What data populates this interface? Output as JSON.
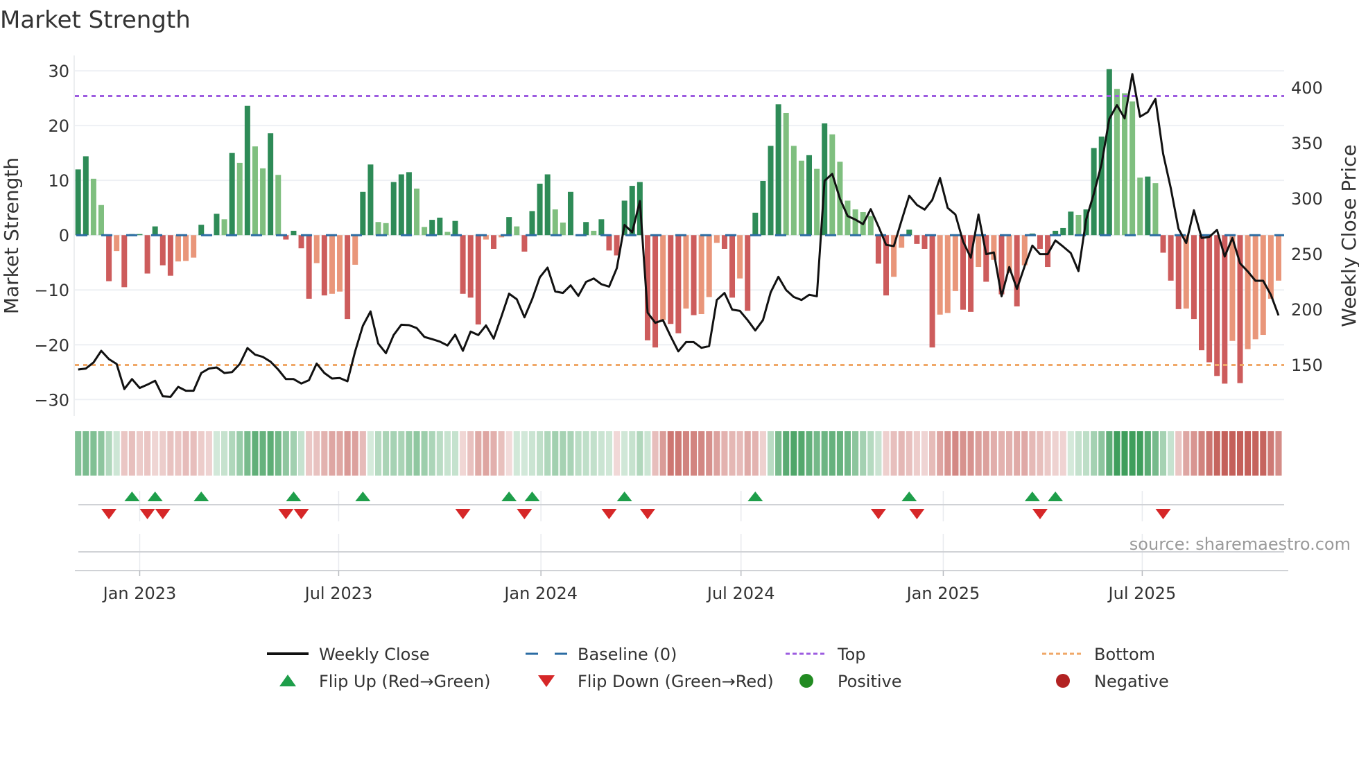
{
  "title": "Market Strength",
  "source": "source: sharemaestro.com",
  "chart_data": {
    "type": "bar",
    "title": "Market Strength",
    "ylabel": "Market Strength",
    "y2label": "Weekly Close Price",
    "ylim": [
      -33,
      32.8
    ],
    "y2lim": [
      103.75,
      428.75
    ],
    "grid": true,
    "yticks": [
      {
        "value": 30,
        "label": "30"
      },
      {
        "value": 20,
        "label": "20"
      },
      {
        "value": 10,
        "label": "10"
      },
      {
        "value": 0,
        "label": "0"
      },
      {
        "value": -10,
        "label": "−10"
      },
      {
        "value": -20,
        "label": "−20"
      },
      {
        "value": -30,
        "label": "−30"
      }
    ],
    "y2ticks": [
      {
        "value": 400,
        "label": "400"
      },
      {
        "value": 350,
        "label": "350"
      },
      {
        "value": 300,
        "label": "300"
      },
      {
        "value": 250,
        "label": "250"
      },
      {
        "value": 200,
        "label": "200"
      },
      {
        "value": 150,
        "label": "150"
      }
    ],
    "xticks": [
      {
        "date": "2023-01-01",
        "label": "Jan 2023"
      },
      {
        "date": "2023-07-01",
        "label": "Jul 2023"
      },
      {
        "date": "2024-01-01",
        "label": "Jan 2024"
      },
      {
        "date": "2024-07-01",
        "label": "Jul 2024"
      },
      {
        "date": "2025-01-01",
        "label": "Jan 2025"
      },
      {
        "date": "2025-07-01",
        "label": "Jul 2025"
      }
    ],
    "x_start": "2022-11-06",
    "x_step_days": 7,
    "baseline": 0,
    "top_level": 25.4,
    "bottom_level": -23.7,
    "strength": [
      12.0,
      14.4,
      10.3,
      5.5,
      -8.4,
      -2.9,
      -9.5,
      0.2,
      0.2,
      -7.0,
      1.6,
      -5.5,
      -7.4,
      -4.8,
      -4.7,
      -4.1,
      1.9,
      0.1,
      3.9,
      2.9,
      15.0,
      13.2,
      23.6,
      16.2,
      12.2,
      18.6,
      11.0,
      -0.8,
      0.8,
      -2.4,
      -11.6,
      -5.1,
      -11.0,
      -10.7,
      -10.3,
      -15.3,
      -5.4,
      7.9,
      12.9,
      2.4,
      2.2,
      9.7,
      11.1,
      11.5,
      8.5,
      1.5,
      2.8,
      3.2,
      0.6,
      2.6,
      -10.7,
      -11.4,
      -16.3,
      -0.8,
      -2.5,
      -0.4,
      3.3,
      1.6,
      -3.0,
      4.4,
      9.4,
      11.1,
      4.7,
      2.3,
      7.9,
      0.1,
      2.4,
      0.8,
      2.9,
      -2.8,
      -3.7,
      6.3,
      9.0,
      9.7,
      -19.2,
      -20.5,
      -15.5,
      -16.2,
      -17.9,
      -13.4,
      -14.6,
      -14.4,
      -11.3,
      -1.4,
      -2.5,
      -11.4,
      -7.9,
      -13.8,
      4.1,
      9.9,
      16.3,
      23.9,
      22.3,
      16.3,
      13.6,
      14.6,
      12.1,
      20.4,
      18.4,
      13.4,
      6.3,
      4.7,
      4.2,
      3.5,
      -5.2,
      -11.0,
      -7.6,
      -2.3,
      1.0,
      -1.6,
      -2.5,
      -20.5,
      -14.5,
      -14.2,
      -10.2,
      -13.6,
      -14.0,
      -5.8,
      -8.5,
      -4.5,
      -10.8,
      -6.9,
      -13.0,
      -5.5,
      0.3,
      -2.5,
      -5.8,
      0.8,
      1.3,
      4.3,
      3.7,
      4.7,
      15.9,
      18.0,
      30.3,
      26.7,
      25.9,
      24.4,
      10.5,
      10.7,
      9.5,
      -3.2,
      -8.3,
      -13.5,
      -13.4,
      -15.3,
      -21.0,
      -23.2,
      -25.7,
      -27.1,
      -19.3,
      -27.0,
      -20.8,
      -19.0,
      -18.2,
      -11.6,
      -8.3
    ],
    "weekly_close": [
      145.6,
      146.5,
      152,
      162.5,
      155,
      150.6,
      128,
      137,
      129,
      132,
      135.5,
      121.5,
      121,
      130,
      126.5,
      126.5,
      142.5,
      146.5,
      147.5,
      142.5,
      143.3,
      150.6,
      165,
      159,
      157,
      152.7,
      145.6,
      137,
      137,
      133,
      136,
      151,
      142.5,
      137.5,
      138,
      135,
      162,
      185,
      198,
      169,
      160.4,
      176.7,
      186,
      185.6,
      183,
      175,
      173,
      170.8,
      167.3,
      177,
      162.5,
      179.8,
      176.7,
      185.4,
      173.5,
      193.3,
      214,
      209,
      192.7,
      209,
      228.8,
      237.5,
      216,
      214.6,
      221.5,
      212,
      224.6,
      227.7,
      222.5,
      220.4,
      237,
      276,
      269.4,
      297.5,
      196.9,
      187.7,
      190.2,
      175.6,
      162,
      170.4,
      170.4,
      165.2,
      166.7,
      208.3,
      214.6,
      199.6,
      198.5,
      190.2,
      180.8,
      190.2,
      215.2,
      229.2,
      217.3,
      211,
      208.3,
      213,
      211.7,
      315.8,
      322,
      299.6,
      284,
      280.8,
      276.7,
      290.2,
      274.6,
      258,
      256.9,
      279.8,
      302.3,
      294,
      289.8,
      298.5,
      318.3,
      291.3,
      285.4,
      261,
      246.5,
      285.4,
      249.6,
      251.2,
      211.7,
      238,
      218.3,
      238.8,
      257.3,
      249.6,
      249.6,
      262,
      256.5,
      250.6,
      234.4,
      280.8,
      304.2,
      330.8,
      371.5,
      384,
      372,
      412,
      373.5,
      377.7,
      389.6,
      340.2,
      309,
      272.5,
      259.6,
      289.2,
      264.2,
      265.2,
      271.5,
      247.5,
      264.2,
      241.3,
      234,
      225.6,
      225.6,
      213,
      194.4
    ],
    "flip_up_weeks": [
      7,
      10,
      16,
      28,
      37,
      56,
      59,
      71,
      88,
      108,
      124,
      127
    ],
    "flip_down_weeks": [
      4,
      9,
      11,
      27,
      29,
      50,
      58,
      69,
      74,
      104,
      109,
      125,
      141
    ],
    "legend_position": "bottom",
    "legend": [
      {
        "label": "Weekly Close",
        "kind": "line"
      },
      {
        "label": "Baseline (0)",
        "kind": "dash"
      },
      {
        "label": "Top",
        "kind": "dot-top"
      },
      {
        "label": "Bottom",
        "kind": "dot-bottom"
      },
      {
        "label": "Flip Up (Red→Green)",
        "kind": "tri-up"
      },
      {
        "label": "Flip Down (Green→Red)",
        "kind": "tri-down"
      },
      {
        "label": "Positive",
        "kind": "circle-pos"
      },
      {
        "label": "Negative",
        "kind": "circle-neg"
      }
    ],
    "colors": {
      "pos_strong": "#2e8b57",
      "pos_weak": "#7fbf7f",
      "neg_strong": "#cd5c5c",
      "neg_weak": "#e9967a",
      "line": "#111111",
      "baseline": "#2b6ca3",
      "top": "#9d5ce0",
      "bottom": "#f0a868",
      "flip_up": "#1e9e4a",
      "flip_down": "#d62728",
      "positive": "#228b22",
      "negative": "#b22222"
    }
  }
}
